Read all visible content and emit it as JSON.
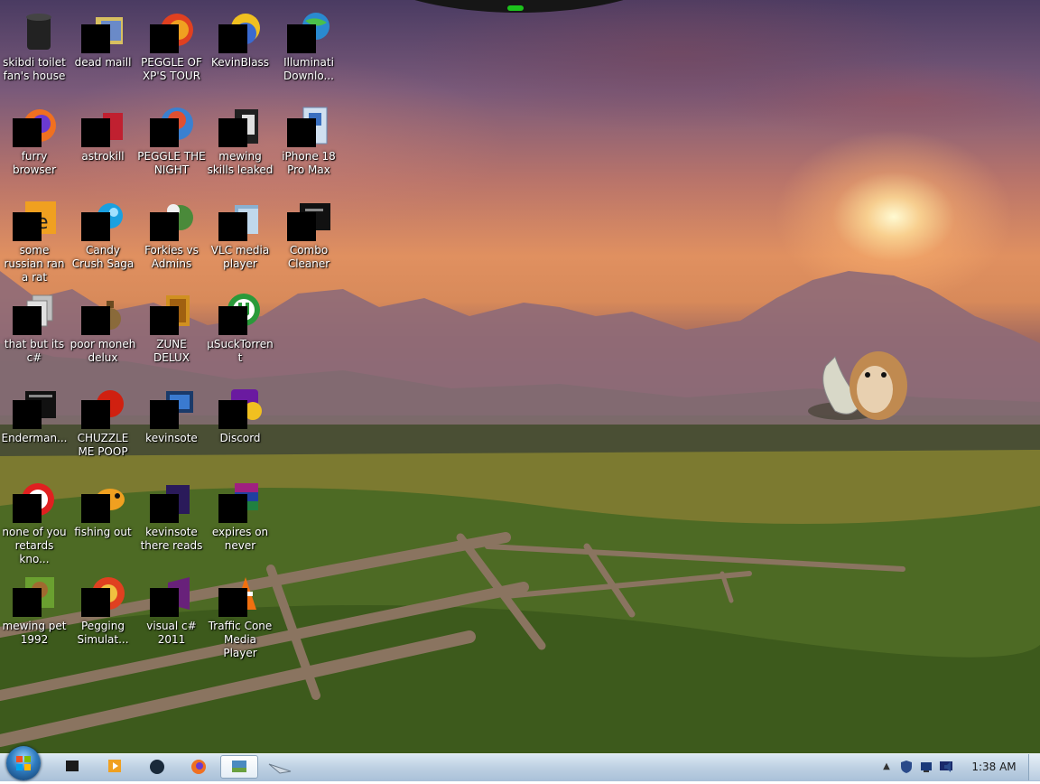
{
  "desktop": {
    "icons": [
      {
        "label": "skibdi toilet fan's house",
        "icon": "trash-bin-icon"
      },
      {
        "label": "dead maill",
        "icon": "mail-folder-icon"
      },
      {
        "label": "PEGGLE OF XP'S TOUR",
        "icon": "peggle-icon"
      },
      {
        "label": "KevinBlass",
        "icon": "sun-ball-icon"
      },
      {
        "label": "Illuminati Downlo...",
        "icon": "globe-icon"
      },
      {
        "label": "furry browser",
        "icon": "firefox-icon"
      },
      {
        "label": "astrokill",
        "icon": "red-book-icon"
      },
      {
        "label": "PEGGLE THE NIGHT",
        "icon": "peggle-night-icon"
      },
      {
        "label": "mewing skills leaked",
        "icon": "black-folder-icon"
      },
      {
        "label": "iPhone 18 Pro Max",
        "icon": "document-icon"
      },
      {
        "label": "some russian ran a rat",
        "icon": "orange-app-icon"
      },
      {
        "label": "Candy Crush Saga",
        "icon": "candy-icon"
      },
      {
        "label": "Forkies vs Admins",
        "icon": "flower-icon"
      },
      {
        "label": "VLC media player",
        "icon": "folder-icon"
      },
      {
        "label": "Combo Cleaner",
        "icon": "terminal-icon"
      },
      {
        "label": "that but its c#",
        "icon": "copy-pages-icon"
      },
      {
        "label": "poor moneh delux",
        "icon": "money-bag-icon"
      },
      {
        "label": "ZUNE DELUX",
        "icon": "gold-box-icon"
      },
      {
        "label": "µSuckTorrent",
        "icon": "utorrent-icon"
      },
      {
        "label": "Enderman...",
        "icon": "window-icon"
      },
      {
        "label": "CHUZZLE ME POOP",
        "icon": "red-fluff-icon"
      },
      {
        "label": "kevinsote",
        "icon": "monitor-icon"
      },
      {
        "label": "Discord",
        "icon": "yahoo-icon"
      },
      {
        "label": "none of you retards kno...",
        "icon": "opera-icon"
      },
      {
        "label": "fishing out",
        "icon": "fish-icon"
      },
      {
        "label": "kevinsote there reads",
        "icon": "dark-app-icon"
      },
      {
        "label": "expires on never",
        "icon": "winrar-icon"
      },
      {
        "label": "mewing pet 1992",
        "icon": "bear-box-icon"
      },
      {
        "label": "Pegging Simulat...",
        "icon": "pegging-ball-icon"
      },
      {
        "label": "visual c# 2011",
        "icon": "visual-studio-icon"
      },
      {
        "label": "Traffic Cone Media Player",
        "icon": "traffic-cone-icon"
      }
    ]
  },
  "taskbar": {
    "start_icon": "windows-orb-icon",
    "pinned": [
      {
        "name": "terminal",
        "icon": "black-window-icon"
      },
      {
        "name": "media-player",
        "icon": "media-player-icon"
      },
      {
        "name": "steam",
        "icon": "dark-circle-icon"
      },
      {
        "name": "firefox",
        "icon": "firefox-icon"
      },
      {
        "name": "desktop-app",
        "icon": "landscape-window-icon",
        "active": true
      },
      {
        "name": "cursor-app",
        "icon": "paper-plane-icon"
      }
    ],
    "tray": {
      "chevron": "▲",
      "icons": [
        "shield-icon",
        "network-icon",
        "monitor-icon",
        "speaker-icon"
      ],
      "clock": "1:38 AM"
    }
  },
  "colors": {
    "label_text": "#ffffff",
    "taskbar_top": "#dbe8f3",
    "taskbar_bottom": "#a9c0d8",
    "widget_accent": "#1cc21c"
  }
}
